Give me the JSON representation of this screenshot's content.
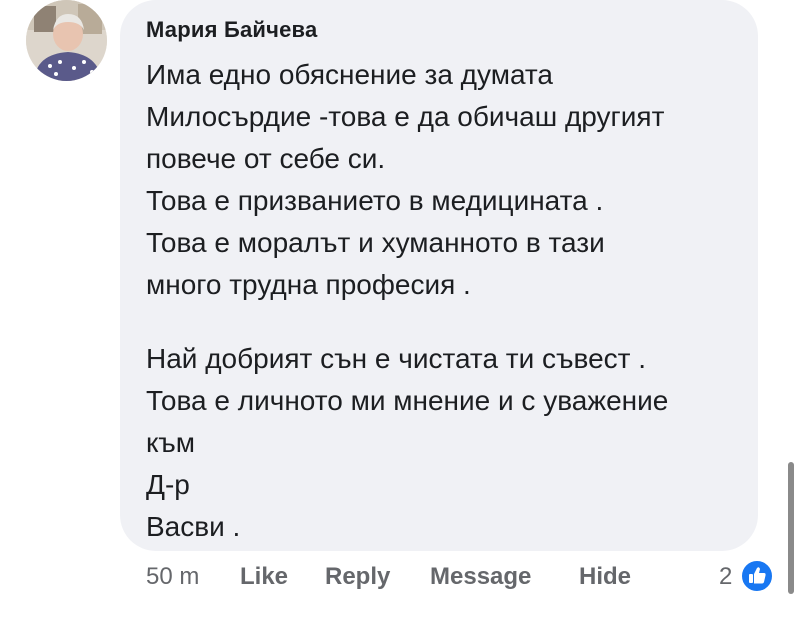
{
  "comment": {
    "author": "Мария Байчева",
    "lines": [
      "Има едно обяснение за думата",
      "Милосърдие -това е да обичаш другият",
      "повече от себе си.",
      "Това е призванието в медицината .",
      "Това е моралът и хуманното в тази",
      "много трудна професия .",
      "",
      "Най добрият сън е чистата ти съвест .",
      "Това е личното ми мнение и с уважение",
      "към",
      "Д-р",
      "Васви ."
    ]
  },
  "actions": {
    "timestamp": "50 m",
    "like_label": "Like",
    "reply_label": "Reply",
    "message_label": "Message",
    "hide_label": "Hide",
    "reaction_count": "2",
    "reaction_icon": "thumbs-up-icon"
  },
  "colors": {
    "bubble": "#f0f1f5",
    "text": "#1c1e21",
    "meta": "#65676b",
    "like_blue": "#1877f2"
  }
}
